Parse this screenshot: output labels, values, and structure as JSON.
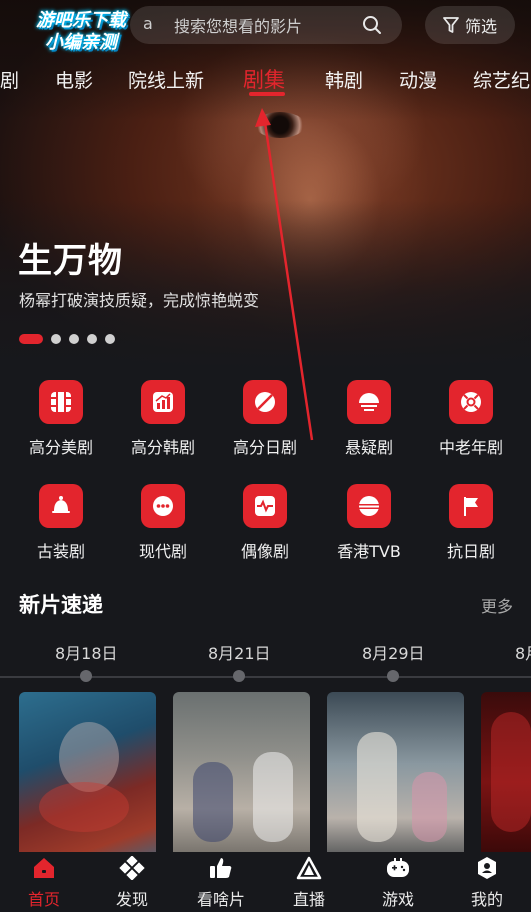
{
  "watermark": {
    "line1": "游吧乐下载",
    "line2": "小编亲测"
  },
  "search": {
    "placeholder": "搜索您想看的影片",
    "peek_char": "a"
  },
  "filter": {
    "label": "筛选"
  },
  "tabs": [
    {
      "label": "剧",
      "active": false
    },
    {
      "label": "电影",
      "active": false
    },
    {
      "label": "院线上新",
      "active": false
    },
    {
      "label": "剧集",
      "active": true
    },
    {
      "label": "韩剧",
      "active": false
    },
    {
      "label": "动漫",
      "active": false
    },
    {
      "label": "综艺纪",
      "active": false
    }
  ],
  "hero": {
    "title": "生万物",
    "subtitle": "杨幂打破演技质疑，完成惊艳蜕变",
    "slide_count": 5,
    "active_slide": 1
  },
  "grid": [
    {
      "label": "高分美剧",
      "icon": "film-icon"
    },
    {
      "label": "高分韩剧",
      "icon": "chart-icon"
    },
    {
      "label": "高分日剧",
      "icon": "disc-slash-icon"
    },
    {
      "label": "悬疑剧",
      "icon": "sunset-icon"
    },
    {
      "label": "中老年剧",
      "icon": "lifebuoy-icon"
    },
    {
      "label": "古装剧",
      "icon": "bell-icon"
    },
    {
      "label": "现代剧",
      "icon": "dots-icon"
    },
    {
      "label": "偶像剧",
      "icon": "pulse-icon"
    },
    {
      "label": "香港TVB",
      "icon": "striped-ball-icon"
    },
    {
      "label": "抗日剧",
      "icon": "flag-icon"
    }
  ],
  "new_releases": {
    "title": "新片速递",
    "more": "更多",
    "dates": [
      "8月18日",
      "8月21日",
      "8月29日",
      "8月"
    ]
  },
  "bottom_nav": [
    {
      "label": "首页",
      "icon": "home-icon",
      "active": true
    },
    {
      "label": "发现",
      "icon": "discover-icon",
      "active": false
    },
    {
      "label": "看啥片",
      "icon": "thumbs-up-icon",
      "active": false
    },
    {
      "label": "直播",
      "icon": "live-icon",
      "active": false
    },
    {
      "label": "游戏",
      "icon": "gamepad-icon",
      "active": false
    },
    {
      "label": "我的",
      "icon": "profile-icon",
      "active": false
    }
  ],
  "colors": {
    "accent": "#e3252d",
    "background": "#17181c"
  }
}
